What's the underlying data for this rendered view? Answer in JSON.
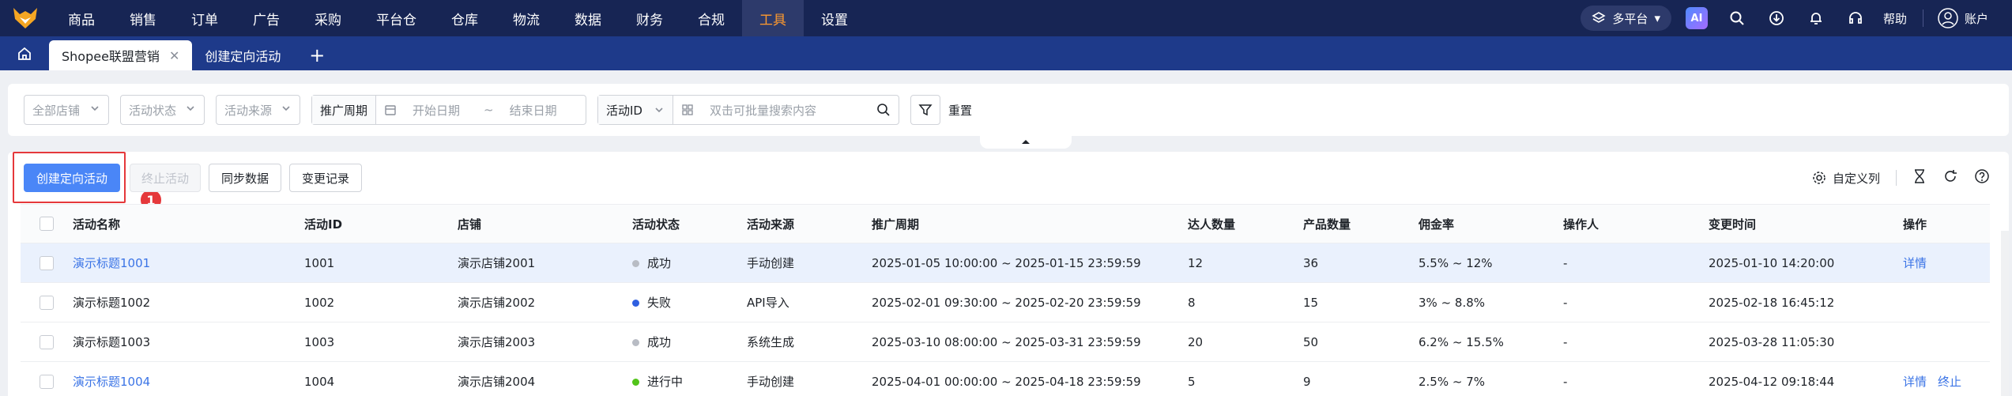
{
  "nav": {
    "menu": [
      "商品",
      "销售",
      "订单",
      "广告",
      "采购",
      "平台仓",
      "仓库",
      "物流",
      "数据",
      "财务",
      "合规",
      "工具",
      "设置"
    ],
    "active_index": 11,
    "platform_label": "多平台",
    "ai_label": "AI",
    "help_label": "帮助",
    "account_label": "账户",
    "icons": [
      "search-icon",
      "download-icon",
      "bell-icon",
      "headset-icon"
    ]
  },
  "tabs": {
    "items": [
      {
        "label": "Shopee联盟营销",
        "active": true,
        "closable": true
      },
      {
        "label": "创建定向活动",
        "active": false,
        "closable": false
      }
    ],
    "add_label": "+"
  },
  "filters": {
    "shop_placeholder": "全部店铺",
    "status_placeholder": "活动状态",
    "source_placeholder": "活动来源",
    "period_label": "推广周期",
    "start_placeholder": "开始日期",
    "range_sep": "~",
    "end_placeholder": "结束日期",
    "id_select": "活动ID",
    "search_placeholder": "双击可批量搜索内容",
    "reset_label": "重置"
  },
  "toolbar": {
    "create_label": "创建定向活动",
    "stop_label": "终止活动",
    "sync_label": "同步数据",
    "log_label": "变更记录",
    "custom_columns_label": "自定义列",
    "step_badge": "1"
  },
  "table": {
    "headers": [
      "活动名称",
      "活动ID",
      "店铺",
      "活动状态",
      "活动来源",
      "推广周期",
      "达人数量",
      "产品数量",
      "佣金率",
      "操作人",
      "变更时间",
      "操作"
    ],
    "rows": [
      {
        "name": "演示标题1001",
        "name_link": true,
        "id": "1001",
        "shop": "演示店铺2001",
        "status": "成功",
        "status_color": "#b8bcc4",
        "source": "手动创建",
        "period": "2025-01-05 10:00:00 ~ 2025-01-15 23:59:59",
        "creators": "12",
        "products": "36",
        "rate": "5.5% ~ 12%",
        "operator": "-",
        "time": "2025-01-10 14:20:00",
        "ops": [
          "详情"
        ],
        "selected": true
      },
      {
        "name": "演示标题1002",
        "name_link": false,
        "id": "1002",
        "shop": "演示店铺2002",
        "status": "失败",
        "status_color": "#2f5fe0",
        "source": "API导入",
        "period": "2025-02-01 09:30:00 ~ 2025-02-20 23:59:59",
        "creators": "8",
        "products": "15",
        "rate": "3% ~ 8.8%",
        "operator": "-",
        "time": "2025-02-18 16:45:12",
        "ops": [],
        "selected": false
      },
      {
        "name": "演示标题1003",
        "name_link": false,
        "id": "1003",
        "shop": "演示店铺2003",
        "status": "成功",
        "status_color": "#b8bcc4",
        "source": "系统生成",
        "period": "2025-03-10 08:00:00 ~ 2025-03-31 23:59:59",
        "creators": "20",
        "products": "50",
        "rate": "6.2% ~ 15.5%",
        "operator": "-",
        "time": "2025-03-28 11:05:30",
        "ops": [],
        "selected": false
      },
      {
        "name": "演示标题1004",
        "name_link": true,
        "id": "1004",
        "shop": "演示店铺2004",
        "status": "进行中",
        "status_color": "#52c41a",
        "source": "手动创建",
        "period": "2025-04-01 00:00:00 ~ 2025-04-18 23:59:59",
        "creators": "5",
        "products": "9",
        "rate": "2.5% ~ 7%",
        "operator": "-",
        "time": "2025-04-12 09:18:44",
        "ops": [
          "详情",
          "终止"
        ],
        "selected": false
      }
    ]
  }
}
